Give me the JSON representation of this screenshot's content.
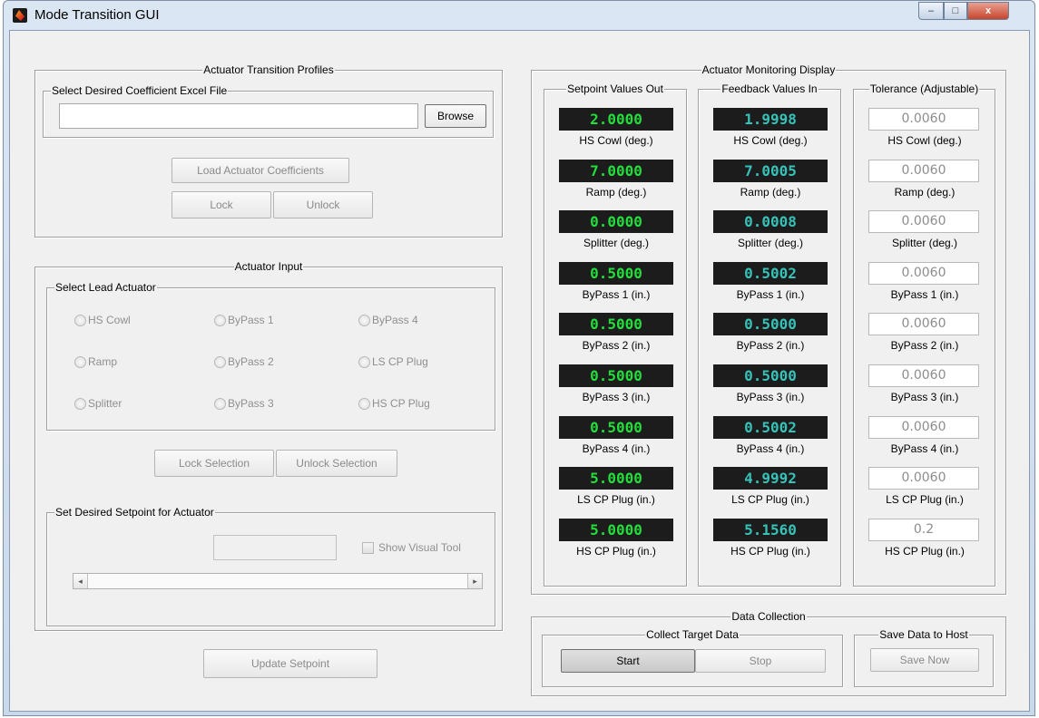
{
  "window": {
    "title": "Mode Transition GUI",
    "min_label": "–",
    "max_label": "□",
    "close_label": "x"
  },
  "profiles": {
    "title": "Actuator Transition Profiles",
    "file_group_title": "Select Desired Coefficient Excel File",
    "file_path_value": "",
    "browse_label": "Browse",
    "load_label": "Load Actuator Coefficients",
    "lock_label": "Lock",
    "unlock_label": "Unlock"
  },
  "actuator_input": {
    "title": "Actuator Input",
    "lead_group_title": "Select Lead Actuator",
    "radios": [
      "HS Cowl",
      "ByPass 1",
      "ByPass 4",
      "Ramp",
      "ByPass 2",
      "LS CP Plug",
      "Splitter",
      "ByPass 3",
      "HS CP Plug"
    ],
    "lock_selection_label": "Lock Selection",
    "unlock_selection_label": "Unlock Selection",
    "setpoint_group_title": "Set Desired Setpoint for Actuator",
    "setpoint_value": "",
    "show_visual_tool_label": "Show Visual Tool",
    "slider_left": "◂",
    "slider_right": "▸",
    "update_setpoint_label": "Update Setpoint"
  },
  "monitoring": {
    "title": "Actuator Monitoring Display",
    "setpoint_title": "Setpoint Values Out",
    "feedback_title": "Feedback Values In",
    "tolerance_title": "Tolerance (Adjustable)",
    "rows": [
      {
        "label": "HS Cowl (deg.)",
        "setpoint": "2.0000",
        "feedback": "1.9998",
        "tolerance": "0.0060"
      },
      {
        "label": "Ramp (deg.)",
        "setpoint": "7.0000",
        "feedback": "7.0005",
        "tolerance": "0.0060"
      },
      {
        "label": "Splitter (deg.)",
        "setpoint": "0.0000",
        "feedback": "0.0008",
        "tolerance": "0.0060"
      },
      {
        "label": "ByPass 1 (in.)",
        "setpoint": "0.5000",
        "feedback": "0.5002",
        "tolerance": "0.0060"
      },
      {
        "label": "ByPass 2 (in.)",
        "setpoint": "0.5000",
        "feedback": "0.5000",
        "tolerance": "0.0060"
      },
      {
        "label": "ByPass 3 (in.)",
        "setpoint": "0.5000",
        "feedback": "0.5000",
        "tolerance": "0.0060"
      },
      {
        "label": "ByPass 4 (in.)",
        "setpoint": "0.5000",
        "feedback": "0.5002",
        "tolerance": "0.0060"
      },
      {
        "label": "LS CP Plug (in.)",
        "setpoint": "5.0000",
        "feedback": "4.9992",
        "tolerance": "0.0060"
      },
      {
        "label": "HS CP Plug (in.)",
        "setpoint": "5.0000",
        "feedback": "5.1560",
        "tolerance": "0.2"
      }
    ],
    "colors": {
      "setpoint_text": "#22dd3a",
      "feedback_text": "#36c2b8",
      "display_bg": "#1c1c1c"
    }
  },
  "data_collection": {
    "title": "Data Collection",
    "collect_title": "Collect Target Data",
    "start_label": "Start",
    "stop_label": "Stop",
    "save_title": "Save Data to Host",
    "save_now_label": "Save Now"
  }
}
